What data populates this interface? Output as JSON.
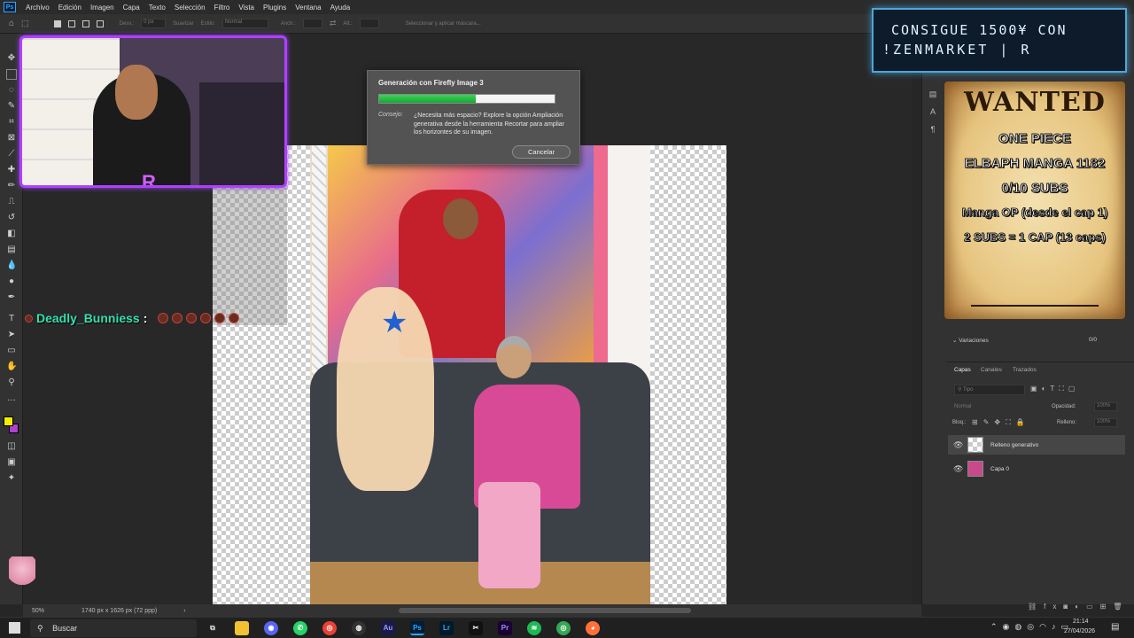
{
  "menu": {
    "items": [
      "Archivo",
      "Edición",
      "Imagen",
      "Capa",
      "Texto",
      "Selección",
      "Filtro",
      "Vista",
      "Plugins",
      "Ventana",
      "Ayuda"
    ]
  },
  "options_bar": {
    "desv_label": "Desv.:",
    "desv_value": "0 px",
    "suavizar": "Suavizar",
    "estilo_label": "Estilo:",
    "estilo_value": "Normal",
    "anch_label": "Anch.:",
    "alt_label": "Alt.:",
    "select_mask": "Seleccionar y aplicar máscara..."
  },
  "dialog": {
    "title": "Generación con Firefly Image 3",
    "progress": 0.55,
    "tip_label": "Consejo:",
    "tip_text": "¿Necesita más espacio? Explore la opción Ampliación generativa desde la herramienta Recortar para ampliar los horizontes de su imagen.",
    "cancel_label": "Cancelar"
  },
  "overlay": {
    "promo_line1": "CONSIGUE 1500¥ CON",
    "promo_line2": "!ZENMARKET | R",
    "wanted_title": "WANTED",
    "wanted_lines": [
      "ONE PIECE",
      "ELBAPH MANGA 1182",
      "0/10 SUBS",
      "Manga OP (desde el cap 1)",
      "2 SUBS = 1 CAP (13 caps)"
    ],
    "chat_user": "Deadly_Bunniess",
    "chat_sep": ":"
  },
  "panels": {
    "variaciones": "Variaciones",
    "variaciones_count": "0/0",
    "tabs": [
      "Capas",
      "Canales",
      "Trazados"
    ],
    "filter_placeholder": "Tipo",
    "blend_mode": "Normal",
    "opacity_label": "Opacidad:",
    "opacity_value": "100%",
    "lock_label": "Bloq.:",
    "fill_label": "Relleno:",
    "fill_value": "100%",
    "layers": [
      {
        "name": "Relleno generativo",
        "selected": true
      },
      {
        "name": "Capa 0",
        "selected": false
      }
    ]
  },
  "status": {
    "zoom": "50%",
    "doc_info": "1740 px x 1626 px (72 ppp)"
  },
  "taskbar": {
    "search": "Buscar",
    "time": "21:14",
    "date": "27/04/2026"
  }
}
